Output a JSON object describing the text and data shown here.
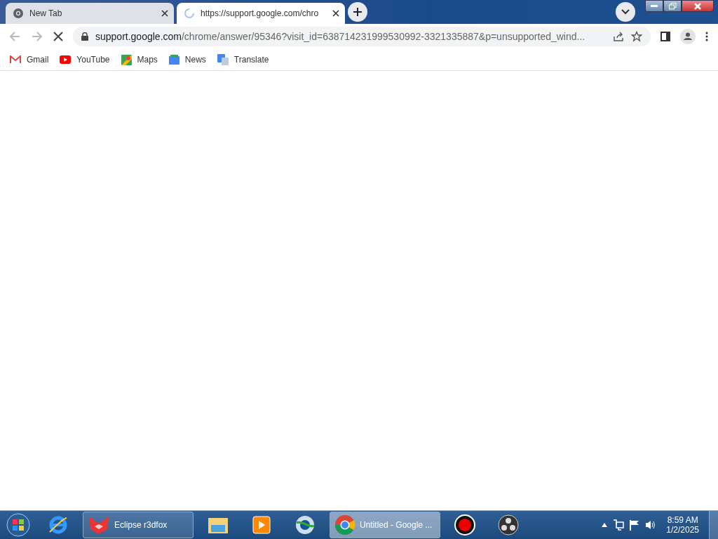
{
  "tabs": [
    {
      "title": "New Tab",
      "selected": false,
      "loading": false
    },
    {
      "title": "https://support.google.com/chro",
      "selected": true,
      "loading": true
    }
  ],
  "toolbar": {
    "url_host": "support.google.com",
    "url_path": "/chrome/answer/95346?visit_id=638714231999530992-3321335887&p=unsupported_wind..."
  },
  "bookmarks": [
    {
      "label": "Gmail",
      "kind": "gmail"
    },
    {
      "label": "YouTube",
      "kind": "youtube"
    },
    {
      "label": "Maps",
      "kind": "maps"
    },
    {
      "label": "News",
      "kind": "news"
    },
    {
      "label": "Translate",
      "kind": "translate"
    }
  ],
  "taskbar": {
    "items": [
      {
        "kind": "ie",
        "selected": false
      },
      {
        "kind": "fox",
        "label": "Eclipse r3dfox",
        "selected": false
      },
      {
        "kind": "folder",
        "selected": false
      },
      {
        "kind": "media",
        "selected": false
      },
      {
        "kind": "globe",
        "selected": false
      },
      {
        "kind": "chrome",
        "label": "Untitled - Google ...",
        "selected": true
      },
      {
        "kind": "record",
        "selected": false
      },
      {
        "kind": "obs",
        "selected": false
      }
    ],
    "time": "8:59 AM",
    "date": "1/2/2025"
  }
}
